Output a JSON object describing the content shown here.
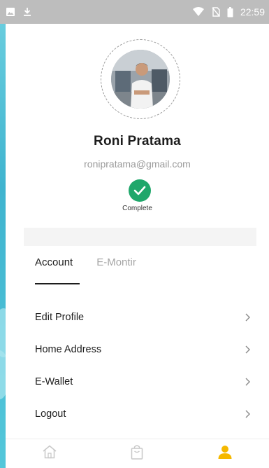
{
  "status_bar": {
    "time": "22:59",
    "left_icons": [
      "image-icon",
      "download-icon"
    ],
    "right_icons": [
      "wifi-icon",
      "no-sim-icon",
      "battery-icon"
    ]
  },
  "profile": {
    "name": "Roni Pratama",
    "email": "ronipratama@gmail.com",
    "verification_status": "Complete",
    "verification_color": "#1fa76b"
  },
  "tabs": [
    {
      "label": "Account",
      "active": true
    },
    {
      "label": "E-Montir",
      "active": false
    }
  ],
  "menu": [
    {
      "label": "Edit Profile"
    },
    {
      "label": "Home Address"
    },
    {
      "label": "E-Wallet"
    },
    {
      "label": "Logout"
    }
  ],
  "bottom_nav": [
    {
      "icon": "home-icon",
      "active": false
    },
    {
      "icon": "shopping-bag-icon",
      "active": false
    },
    {
      "icon": "profile-icon",
      "active": true
    }
  ],
  "colors": {
    "accent": "#f5b800",
    "inactive_icon": "#c8c8c8",
    "status_bar": "#bdbdbd"
  }
}
